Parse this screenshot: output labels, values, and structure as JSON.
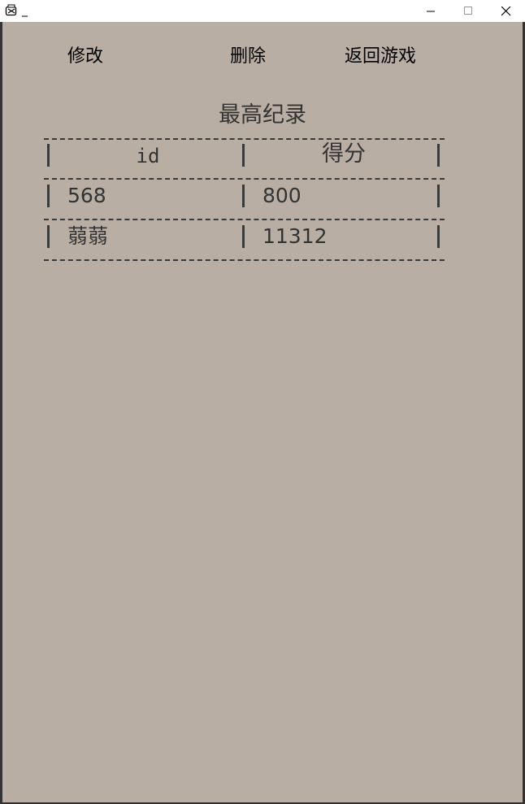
{
  "window": {
    "title": "_"
  },
  "toolbar": {
    "edit_label": "修改",
    "delete_label": "删除",
    "back_label": "返回游戏"
  },
  "leaderboard": {
    "title": "最高纪录",
    "columns": [
      "id",
      "得分"
    ],
    "rows": [
      {
        "id": "568",
        "score": "800"
      },
      {
        "id": "蒻蒻",
        "score": "11312"
      }
    ]
  },
  "colors": {
    "background": "#b8aea3",
    "text": "#333333"
  }
}
